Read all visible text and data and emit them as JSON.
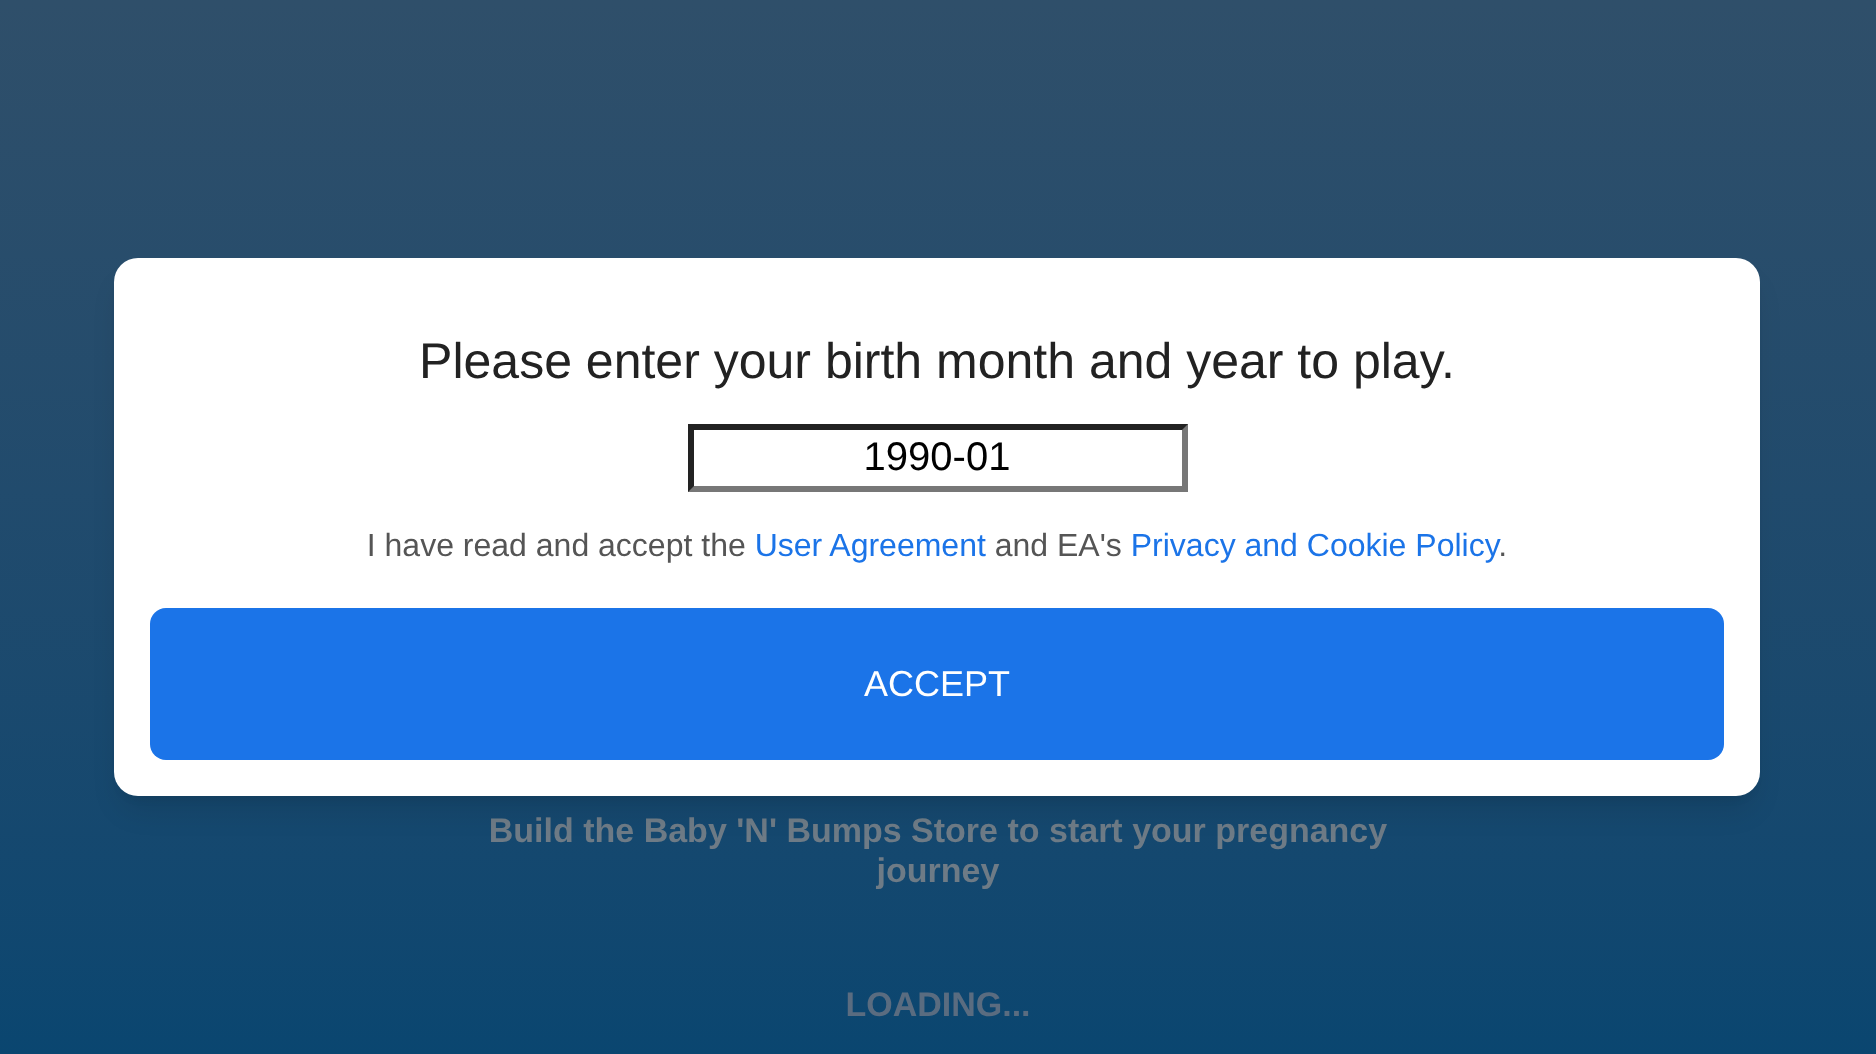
{
  "dialog": {
    "title": "Please enter your birth month and year to play.",
    "birth_field": {
      "value": "1990-01"
    },
    "consent": [
      {
        "kind": "text",
        "text": "I have read and accept the "
      },
      {
        "kind": "link",
        "text": "User Agreement"
      },
      {
        "kind": "text",
        "text": " and EA's "
      },
      {
        "kind": "link",
        "text": "Privacy and Cookie Policy"
      },
      {
        "kind": "text",
        "text": "."
      }
    ],
    "accept_button": "ACCEPT"
  },
  "background": {
    "tip": "Build the Baby 'N' Bumps Store to start your pregnancy journey",
    "loading": "LOADING..."
  }
}
